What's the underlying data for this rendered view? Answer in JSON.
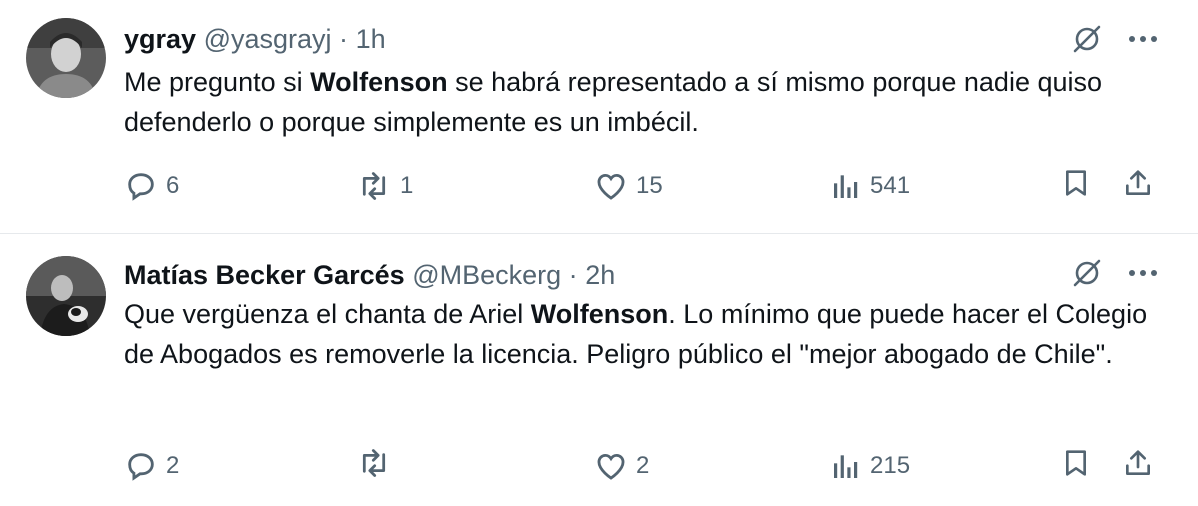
{
  "tweets": [
    {
      "name": "ygray",
      "handle": "@yasgrayj",
      "separator": "·",
      "time": "1h",
      "body_parts": [
        "Me pregunto si ",
        "Wolfenson",
        " se habrá representado a sí mismo porque nadie quiso defenderlo o porque simplemente es un imbécil."
      ],
      "replies": "6",
      "reposts": "1",
      "likes": "15",
      "views": "541",
      "avatar_colors": {
        "bg": "#6b6b6b",
        "face": "#cfcfcf"
      }
    },
    {
      "name": "Matías Becker Garcés",
      "handle": "@MBeckerg",
      "separator": "·",
      "time": "2h",
      "body_parts": [
        "Que vergüenza el chanta de Ariel ",
        "Wolfenson",
        ". Lo mínimo que puede hacer el Colegio de Abogados es removerle la licencia. Peligro público el \"mejor abogado de Chile\"."
      ],
      "replies": "2",
      "reposts": "",
      "likes": "2",
      "views": "215",
      "avatar_colors": {
        "bg": "#3a3a3a",
        "face": "#b8b8b8"
      }
    }
  ],
  "icons": {
    "grok": "grok-icon",
    "more": "more-icon",
    "reply": "reply-icon",
    "repost": "repost-icon",
    "like": "like-icon",
    "views": "views-icon",
    "bookmark": "bookmark-icon",
    "share": "share-icon"
  },
  "colors": {
    "text": "#0f1419",
    "secondary": "#536471",
    "divider": "#e6e9ec"
  }
}
